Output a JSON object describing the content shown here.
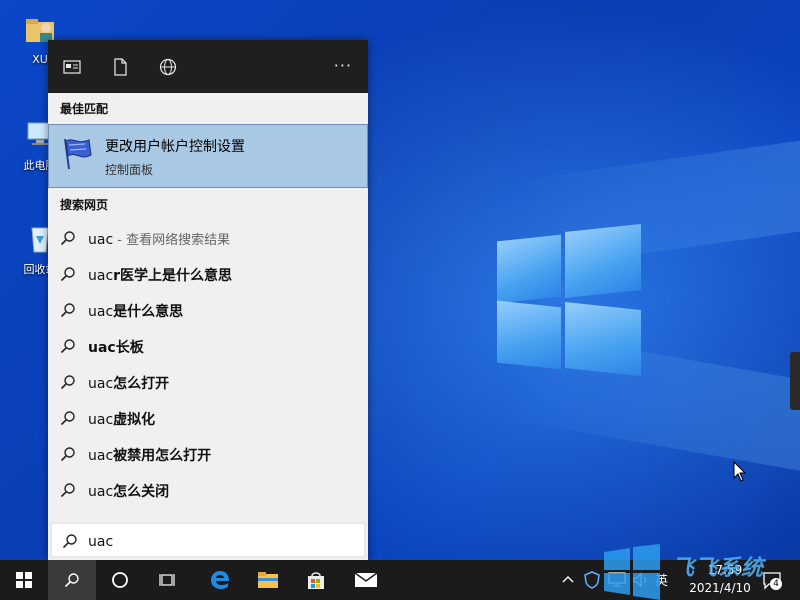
{
  "desktop": {
    "icons": [
      {
        "label": "XU",
        "icon": "user-folder-icon"
      },
      {
        "label": "此电脑",
        "icon": "computer-icon"
      },
      {
        "label": "回收站",
        "icon": "recycle-bin-icon"
      }
    ]
  },
  "search_panel": {
    "toolbar": {
      "icons": [
        "apps-icon",
        "documents-icon",
        "web-icon"
      ],
      "more_label": "···"
    },
    "best_match_title": "最佳匹配",
    "best_match": {
      "title": "更改用户帐户控制设置",
      "subtitle": "控制面板",
      "icon": "uac-flag-icon"
    },
    "web_title": "搜索网页",
    "suggestions": [
      {
        "prefix": "uac",
        "rest": "",
        "hint": " - 查看网络搜索结果"
      },
      {
        "prefix": "uac",
        "rest": "r医学上是什么意思",
        "hint": ""
      },
      {
        "prefix": "uac",
        "rest": "是什么意思",
        "hint": ""
      },
      {
        "prefix": "ua",
        "rest": "c长板",
        "hint": ""
      },
      {
        "prefix": "uac",
        "rest": "怎么打开",
        "hint": ""
      },
      {
        "prefix": "uac",
        "rest": "虚拟化",
        "hint": ""
      },
      {
        "prefix": "uac",
        "rest": "被禁用怎么打开",
        "hint": ""
      },
      {
        "prefix": "uac",
        "rest": "怎么关闭",
        "hint": ""
      }
    ],
    "query": "uac"
  },
  "taskbar": {
    "items": [
      "start-icon",
      "search-icon",
      "cortana-icon",
      "task-view-icon",
      "edge-icon",
      "file-explorer-icon",
      "store-icon",
      "mail-icon"
    ],
    "tray": {
      "ime": "英",
      "time": "17:59",
      "date": "2021/4/10",
      "notification_count": "4"
    }
  },
  "watermark_text": "飞飞系统",
  "colors": {
    "accent": "#0b47c9",
    "best_match_bg": "#a9c8e4",
    "panel_bg": "#f0f0f0",
    "taskbar_bg": "#1b1b1b"
  }
}
